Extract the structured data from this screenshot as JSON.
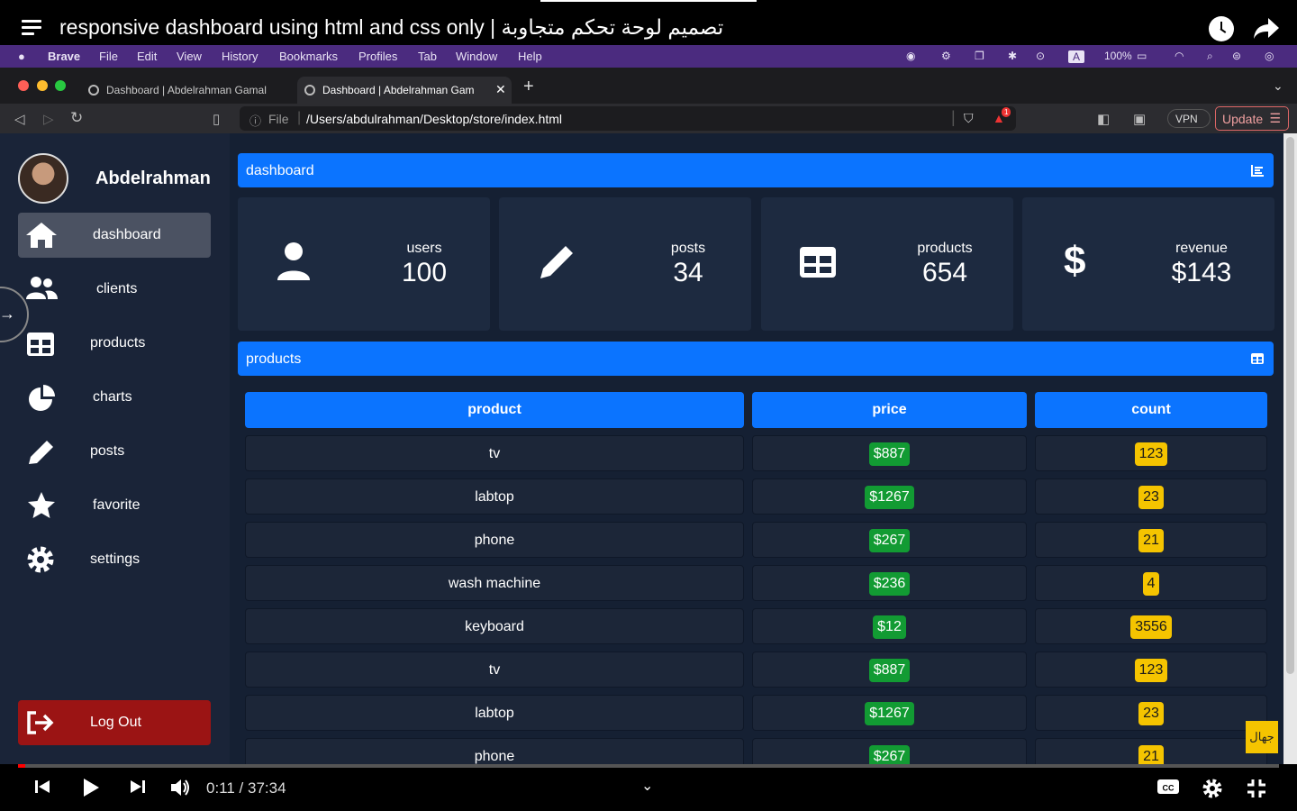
{
  "youtube": {
    "title": "responsive dashboard using html and css only | تصميم لوحة تحكم متجاوبة",
    "time": "0:11 / 37:34",
    "progress_fraction": 0.005
  },
  "mac_menu": {
    "app": "Brave",
    "items": [
      "File",
      "Edit",
      "View",
      "History",
      "Bookmarks",
      "Profiles",
      "Tab",
      "Window",
      "Help"
    ],
    "battery": "100%"
  },
  "browser": {
    "tabs": [
      {
        "label": "Dashboard | Abdelrahman Gamal"
      },
      {
        "label": "Dashboard | Abdelrahman Gam"
      }
    ],
    "url_scheme": "File",
    "url": "/Users/abdulrahman/Desktop/store/index.html",
    "vpn_label": "VPN",
    "update_label": "Update",
    "alert_count": "1"
  },
  "sidebar": {
    "username": "Abdelrahman",
    "items": [
      {
        "label": "dashboard",
        "icon": "home-icon",
        "active": true
      },
      {
        "label": "clients",
        "icon": "users-icon"
      },
      {
        "label": "products",
        "icon": "table-icon"
      },
      {
        "label": "charts",
        "icon": "pie-chart-icon"
      },
      {
        "label": "posts",
        "icon": "pencil-icon"
      },
      {
        "label": "favorite",
        "icon": "star-icon"
      },
      {
        "label": "settings",
        "icon": "gear-icon"
      }
    ],
    "logout_label": "Log Out"
  },
  "dashboard": {
    "title": "dashboard",
    "cards": [
      {
        "label": "users",
        "value": "100",
        "icon": "user-icon"
      },
      {
        "label": "posts",
        "value": "34",
        "icon": "pencil-icon"
      },
      {
        "label": "products",
        "value": "654",
        "icon": "table-icon"
      },
      {
        "label": "revenue",
        "value": "$143",
        "icon": "dollar-icon"
      }
    ]
  },
  "products": {
    "title": "products",
    "headers": [
      "product",
      "price",
      "count"
    ],
    "rows": [
      [
        "tv",
        "$887",
        "123"
      ],
      [
        "labtop",
        "$1267",
        "23"
      ],
      [
        "phone",
        "$267",
        "21"
      ],
      [
        "wash machine",
        "$236",
        "4"
      ],
      [
        "keyboard",
        "$12",
        "3556"
      ],
      [
        "tv",
        "$887",
        "123"
      ],
      [
        "labtop",
        "$1267",
        "23"
      ],
      [
        "phone",
        "$267",
        "21"
      ]
    ]
  },
  "channel_badge": "جهال",
  "colors": {
    "accent": "#0b74ff",
    "price_badge": "#129b33",
    "count_badge": "#f5c400",
    "logout": "#9b1414",
    "menu_bar": "#4b2b7f"
  }
}
